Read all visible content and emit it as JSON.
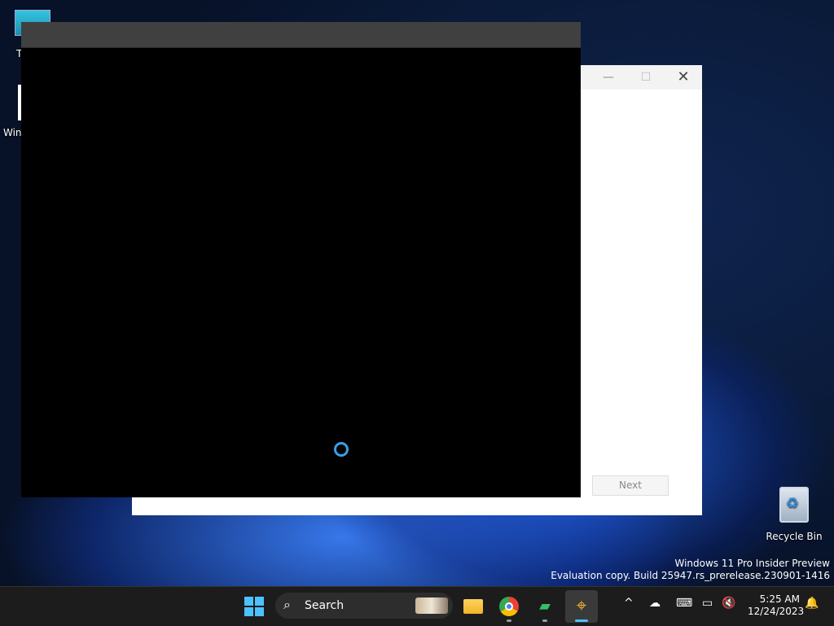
{
  "desktop": {
    "icons": [
      {
        "label": "T"
      },
      {
        "label": "Win"
      }
    ],
    "recycle_bin": {
      "label": "Recycle Bin"
    },
    "watermark": {
      "line1": "Windows 11 Pro Insider Preview",
      "line2": "Evaluation copy. Build 25947.rs_prerelease.230901-1416"
    }
  },
  "background_window": {
    "controls": {
      "minimize": "—",
      "maximize": "☐",
      "close": "✕"
    },
    "next_label": "Next"
  },
  "taskbar": {
    "search": {
      "label": "Search",
      "icon": "search-icon"
    },
    "apps": [
      "start-icon",
      "file-explorer-icon",
      "chrome-icon",
      "green-app-icon",
      "active-app-icon"
    ],
    "tray": {
      "chevron": "^",
      "cloud": "☁",
      "keyboard": "⌨",
      "display": "▭",
      "sound": "🔇",
      "bell": "🔔"
    },
    "clock": {
      "time": "5:25 AM",
      "date": "12/24/2023"
    }
  }
}
